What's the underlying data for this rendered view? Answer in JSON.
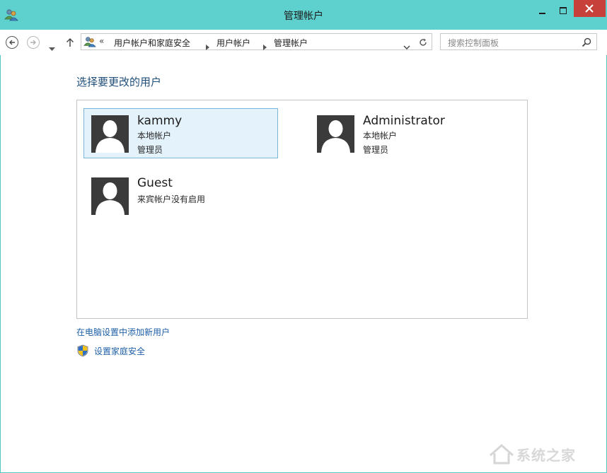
{
  "window": {
    "title": "管理帐户",
    "controls": {
      "minimize": "minimize-icon",
      "maximize": "maximize-icon",
      "close": "close-icon"
    },
    "colors": {
      "titlebar": "#5ed0cd",
      "close_button": "#c8403a",
      "link": "#1e5fa8",
      "heading": "#1f4e79"
    }
  },
  "nav": {
    "back_icon": "back-arrow-icon",
    "forward_icon": "forward-arrow-icon",
    "recent_icon": "chevron-down-icon",
    "up_icon": "up-arrow-icon"
  },
  "address": {
    "overflow": "«",
    "crumbs": [
      "用户帐户和家庭安全",
      "用户帐户",
      "管理帐户"
    ]
  },
  "search": {
    "placeholder": "搜索控制面板"
  },
  "main": {
    "heading": "选择要更改的用户",
    "accounts": [
      {
        "name": "kammy",
        "lines": [
          "本地帐户",
          "管理员"
        ],
        "selected": true
      },
      {
        "name": "Administrator",
        "lines": [
          "本地帐户",
          "管理员"
        ],
        "selected": false
      },
      {
        "name": "Guest",
        "lines": [
          "来宾帐户没有启用"
        ],
        "selected": false
      }
    ],
    "links": {
      "add_user": "在电脑设置中添加新用户",
      "family_safety": "设置家庭安全"
    }
  },
  "watermark": {
    "text": "系统之家"
  }
}
